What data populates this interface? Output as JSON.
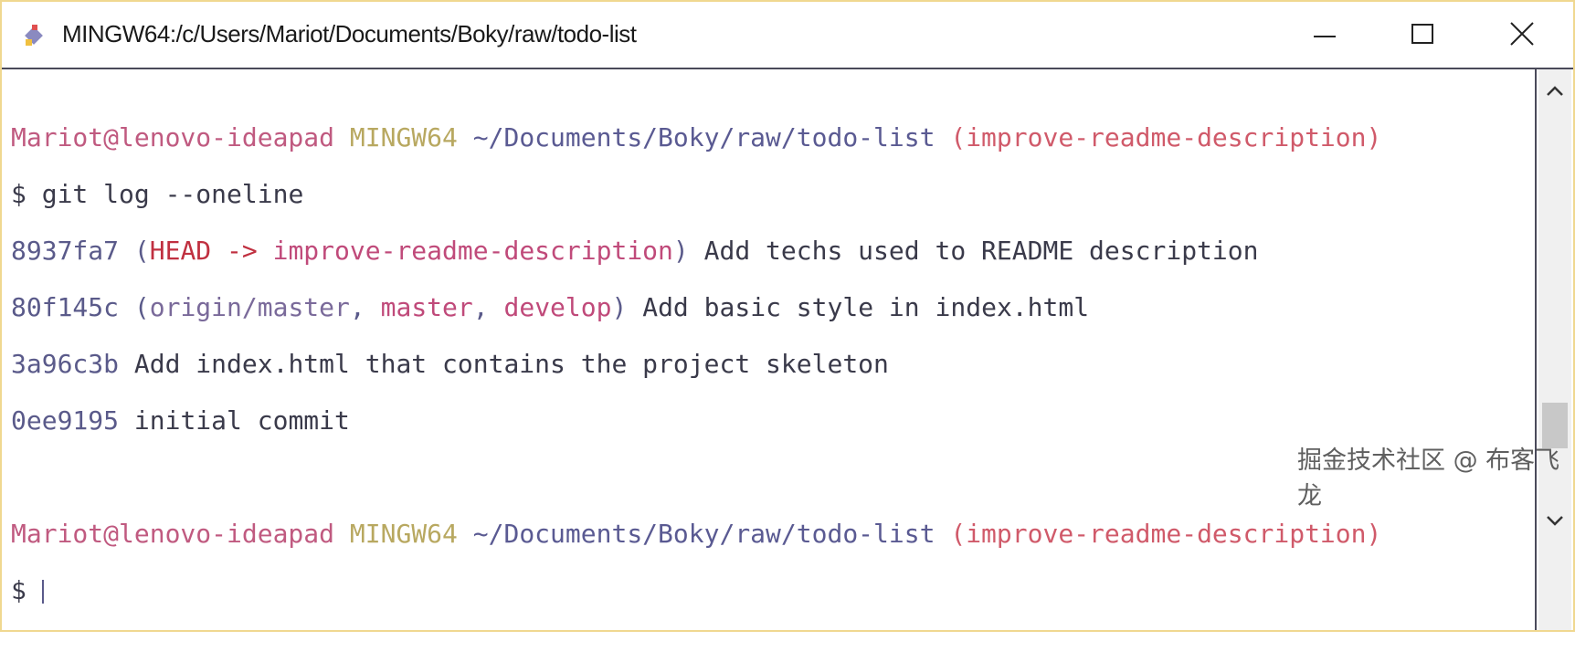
{
  "window": {
    "title": "MINGW64:/c/Users/Mariot/Documents/Boky/raw/todo-list"
  },
  "controls": {
    "minimize": "minimize-icon",
    "maximize": "maximize-icon",
    "close": "close-icon"
  },
  "prompt": {
    "user": "Mariot@lenovo-ideapad",
    "host": "MINGW64",
    "path": "~/Documents/Boky/raw/todo-list",
    "branch": "(improve-readme-description)",
    "symbol": "$"
  },
  "command": "git log --oneline",
  "commits": [
    {
      "hash": "8937fa7",
      "open": " (",
      "head": "HEAD -> ",
      "ref1": "improve-readme-description",
      "close": ")",
      "message": " Add techs used to README description"
    },
    {
      "hash": "80f145c",
      "open": " (",
      "ref0": "origin/master",
      "sep1": ", ",
      "ref1": "master",
      "sep2": ", ",
      "ref2": "develop",
      "close": ")",
      "message": " Add basic style in index.html"
    },
    {
      "hash": "3a96c3b",
      "message": " Add index.html that contains the project skeleton"
    },
    {
      "hash": "0ee9195",
      "message": " initial commit"
    }
  ],
  "watermark": "掘金技术社区 @ 布客飞龙"
}
